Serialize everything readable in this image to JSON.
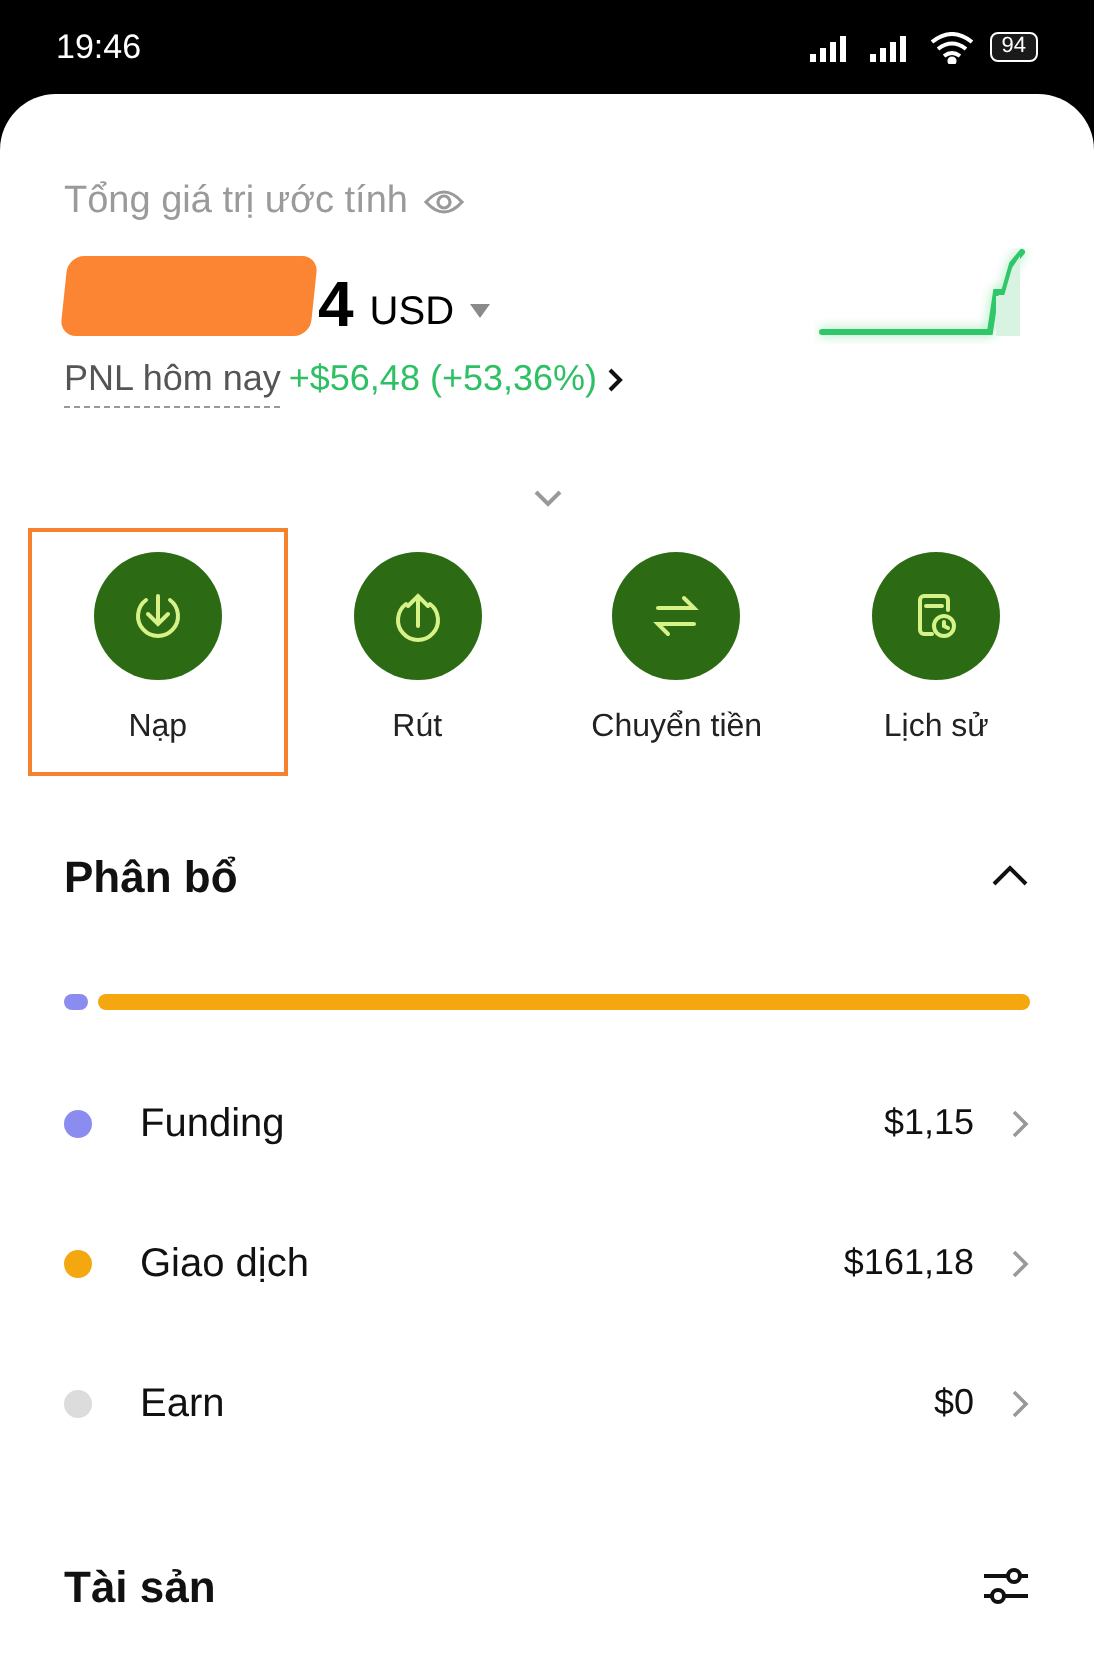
{
  "status_bar": {
    "time": "19:46",
    "battery": "94"
  },
  "overview": {
    "label": "Tổng giá trị ước tính",
    "balance_visible": "4",
    "currency": "USD",
    "pnl_label": "PNL hôm nay",
    "pnl_value": "+$56,48 (+53,36%)"
  },
  "actions": [
    {
      "label": "Nạp",
      "kind": "deposit",
      "selected": true
    },
    {
      "label": "Rút",
      "kind": "withdraw",
      "selected": false
    },
    {
      "label": "Chuyển tiền",
      "kind": "transfer",
      "selected": false
    },
    {
      "label": "Lịch sử",
      "kind": "history",
      "selected": false
    }
  ],
  "allocation": {
    "title": "Phân bổ",
    "expanded": true,
    "items": [
      {
        "name": "Funding",
        "value": "$1,15",
        "color": "#8b8cf0"
      },
      {
        "name": "Giao dịch",
        "value": "$161,18",
        "color": "#f5a70f"
      },
      {
        "name": "Earn",
        "value": "$0",
        "color": "#dcdcdc"
      }
    ]
  },
  "assets": {
    "title": "Tài sản"
  }
}
